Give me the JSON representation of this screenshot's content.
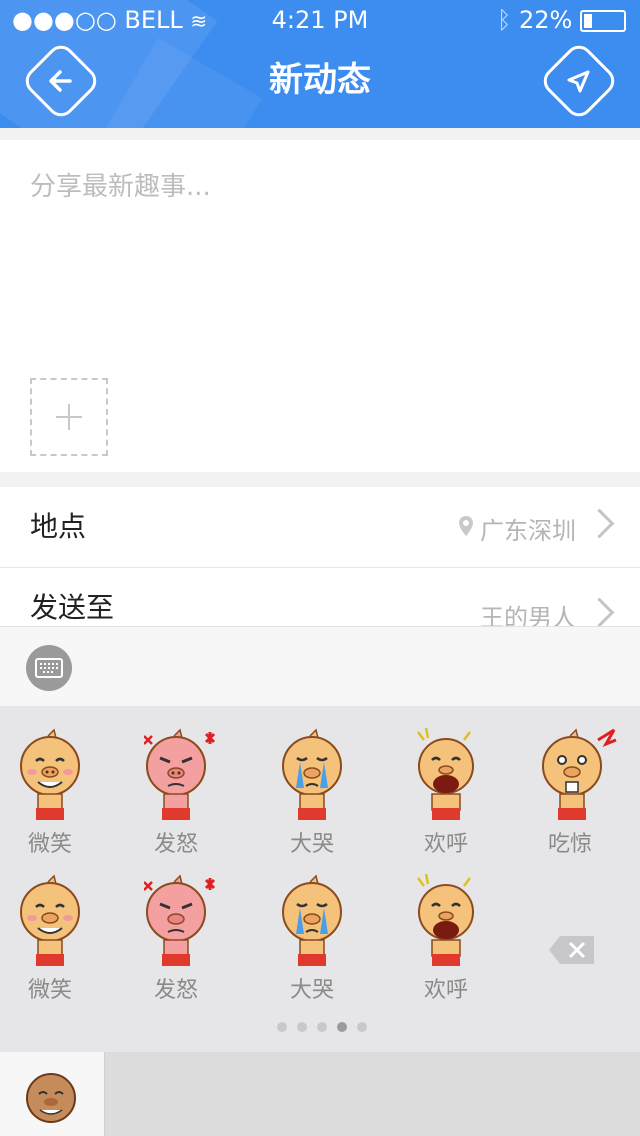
{
  "status": {
    "carrier": "BELL",
    "time": "4:21 PM",
    "battery": "22%"
  },
  "header": {
    "title": "新动态",
    "back_icon": "arrow-left-icon",
    "send_icon": "send-icon"
  },
  "compose": {
    "placeholder": "分享最新趣事..."
  },
  "location": {
    "label": "地点",
    "value": "广东深圳"
  },
  "send_to": {
    "label": "发送至",
    "value": "王的男人"
  },
  "emojis": {
    "row1": [
      "微笑",
      "发怒",
      "大哭",
      "欢呼",
      "吃惊"
    ],
    "row2": [
      "微笑",
      "发怒",
      "大哭",
      "欢呼"
    ]
  },
  "pager": {
    "pages": 5,
    "current": 4
  },
  "colors": {
    "header": "#3d8cf0",
    "pig_skin": "#f4c27a",
    "pig_angry": "#f4a0a0"
  }
}
